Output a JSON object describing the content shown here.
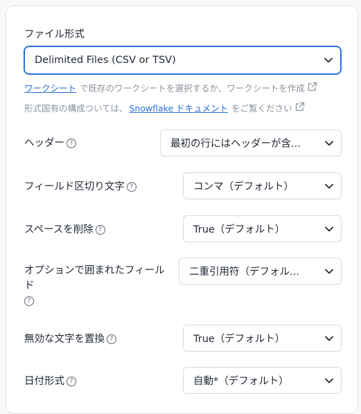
{
  "file_format": {
    "label": "ファイル形式",
    "selected": "Delimited Files (CSV or TSV)"
  },
  "hints": {
    "line1_link": "ワークシート",
    "line1_text": "で既存のワークシートを選択するか、ワークシートを作成",
    "line2_prefix": "形式固有の構成ついては、",
    "line2_link": "Snowflake ドキュメント",
    "line2_suffix": "をご覧ください"
  },
  "rows": [
    {
      "label": "ヘッダー",
      "value": "最初の行にはヘッダーが含..."
    },
    {
      "label": "フィールド区切り文字",
      "value": "コンマ（デフォルト）"
    },
    {
      "label": "スペースを削除",
      "value": "True（デフォルト）"
    },
    {
      "label_line1": "オプションで囲まれたフィール",
      "label_line2": "ド",
      "value": "二重引用符（デフォル..."
    },
    {
      "label": "無効な文字を置換",
      "value": "True（デフォルト）"
    },
    {
      "label": "日付形式",
      "value": "自動*（デフォルト）"
    }
  ],
  "icons": {
    "help": "question-circle-icon",
    "chevron": "chevron-down-icon",
    "external": "external-link-icon"
  },
  "colors": {
    "accent": "#2a6edb",
    "text": "#1f2733",
    "muted": "#8a939e",
    "border": "#d5dae0"
  }
}
